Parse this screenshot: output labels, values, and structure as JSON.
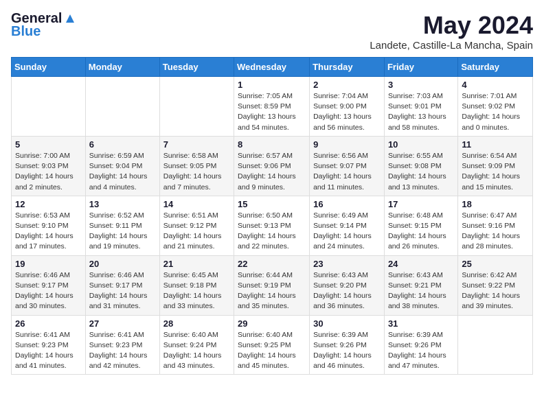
{
  "logo": {
    "general": "General",
    "blue": "Blue"
  },
  "header": {
    "month": "May 2024",
    "location": "Landete, Castille-La Mancha, Spain"
  },
  "weekdays": [
    "Sunday",
    "Monday",
    "Tuesday",
    "Wednesday",
    "Thursday",
    "Friday",
    "Saturday"
  ],
  "weeks": [
    [
      {
        "day": "",
        "info": ""
      },
      {
        "day": "",
        "info": ""
      },
      {
        "day": "",
        "info": ""
      },
      {
        "day": "1",
        "info": "Sunrise: 7:05 AM\nSunset: 8:59 PM\nDaylight: 13 hours\nand 54 minutes."
      },
      {
        "day": "2",
        "info": "Sunrise: 7:04 AM\nSunset: 9:00 PM\nDaylight: 13 hours\nand 56 minutes."
      },
      {
        "day": "3",
        "info": "Sunrise: 7:03 AM\nSunset: 9:01 PM\nDaylight: 13 hours\nand 58 minutes."
      },
      {
        "day": "4",
        "info": "Sunrise: 7:01 AM\nSunset: 9:02 PM\nDaylight: 14 hours\nand 0 minutes."
      }
    ],
    [
      {
        "day": "5",
        "info": "Sunrise: 7:00 AM\nSunset: 9:03 PM\nDaylight: 14 hours\nand 2 minutes."
      },
      {
        "day": "6",
        "info": "Sunrise: 6:59 AM\nSunset: 9:04 PM\nDaylight: 14 hours\nand 4 minutes."
      },
      {
        "day": "7",
        "info": "Sunrise: 6:58 AM\nSunset: 9:05 PM\nDaylight: 14 hours\nand 7 minutes."
      },
      {
        "day": "8",
        "info": "Sunrise: 6:57 AM\nSunset: 9:06 PM\nDaylight: 14 hours\nand 9 minutes."
      },
      {
        "day": "9",
        "info": "Sunrise: 6:56 AM\nSunset: 9:07 PM\nDaylight: 14 hours\nand 11 minutes."
      },
      {
        "day": "10",
        "info": "Sunrise: 6:55 AM\nSunset: 9:08 PM\nDaylight: 14 hours\nand 13 minutes."
      },
      {
        "day": "11",
        "info": "Sunrise: 6:54 AM\nSunset: 9:09 PM\nDaylight: 14 hours\nand 15 minutes."
      }
    ],
    [
      {
        "day": "12",
        "info": "Sunrise: 6:53 AM\nSunset: 9:10 PM\nDaylight: 14 hours\nand 17 minutes."
      },
      {
        "day": "13",
        "info": "Sunrise: 6:52 AM\nSunset: 9:11 PM\nDaylight: 14 hours\nand 19 minutes."
      },
      {
        "day": "14",
        "info": "Sunrise: 6:51 AM\nSunset: 9:12 PM\nDaylight: 14 hours\nand 21 minutes."
      },
      {
        "day": "15",
        "info": "Sunrise: 6:50 AM\nSunset: 9:13 PM\nDaylight: 14 hours\nand 22 minutes."
      },
      {
        "day": "16",
        "info": "Sunrise: 6:49 AM\nSunset: 9:14 PM\nDaylight: 14 hours\nand 24 minutes."
      },
      {
        "day": "17",
        "info": "Sunrise: 6:48 AM\nSunset: 9:15 PM\nDaylight: 14 hours\nand 26 minutes."
      },
      {
        "day": "18",
        "info": "Sunrise: 6:47 AM\nSunset: 9:16 PM\nDaylight: 14 hours\nand 28 minutes."
      }
    ],
    [
      {
        "day": "19",
        "info": "Sunrise: 6:46 AM\nSunset: 9:17 PM\nDaylight: 14 hours\nand 30 minutes."
      },
      {
        "day": "20",
        "info": "Sunrise: 6:46 AM\nSunset: 9:17 PM\nDaylight: 14 hours\nand 31 minutes."
      },
      {
        "day": "21",
        "info": "Sunrise: 6:45 AM\nSunset: 9:18 PM\nDaylight: 14 hours\nand 33 minutes."
      },
      {
        "day": "22",
        "info": "Sunrise: 6:44 AM\nSunset: 9:19 PM\nDaylight: 14 hours\nand 35 minutes."
      },
      {
        "day": "23",
        "info": "Sunrise: 6:43 AM\nSunset: 9:20 PM\nDaylight: 14 hours\nand 36 minutes."
      },
      {
        "day": "24",
        "info": "Sunrise: 6:43 AM\nSunset: 9:21 PM\nDaylight: 14 hours\nand 38 minutes."
      },
      {
        "day": "25",
        "info": "Sunrise: 6:42 AM\nSunset: 9:22 PM\nDaylight: 14 hours\nand 39 minutes."
      }
    ],
    [
      {
        "day": "26",
        "info": "Sunrise: 6:41 AM\nSunset: 9:23 PM\nDaylight: 14 hours\nand 41 minutes."
      },
      {
        "day": "27",
        "info": "Sunrise: 6:41 AM\nSunset: 9:23 PM\nDaylight: 14 hours\nand 42 minutes."
      },
      {
        "day": "28",
        "info": "Sunrise: 6:40 AM\nSunset: 9:24 PM\nDaylight: 14 hours\nand 43 minutes."
      },
      {
        "day": "29",
        "info": "Sunrise: 6:40 AM\nSunset: 9:25 PM\nDaylight: 14 hours\nand 45 minutes."
      },
      {
        "day": "30",
        "info": "Sunrise: 6:39 AM\nSunset: 9:26 PM\nDaylight: 14 hours\nand 46 minutes."
      },
      {
        "day": "31",
        "info": "Sunrise: 6:39 AM\nSunset: 9:26 PM\nDaylight: 14 hours\nand 47 minutes."
      },
      {
        "day": "",
        "info": ""
      }
    ]
  ]
}
